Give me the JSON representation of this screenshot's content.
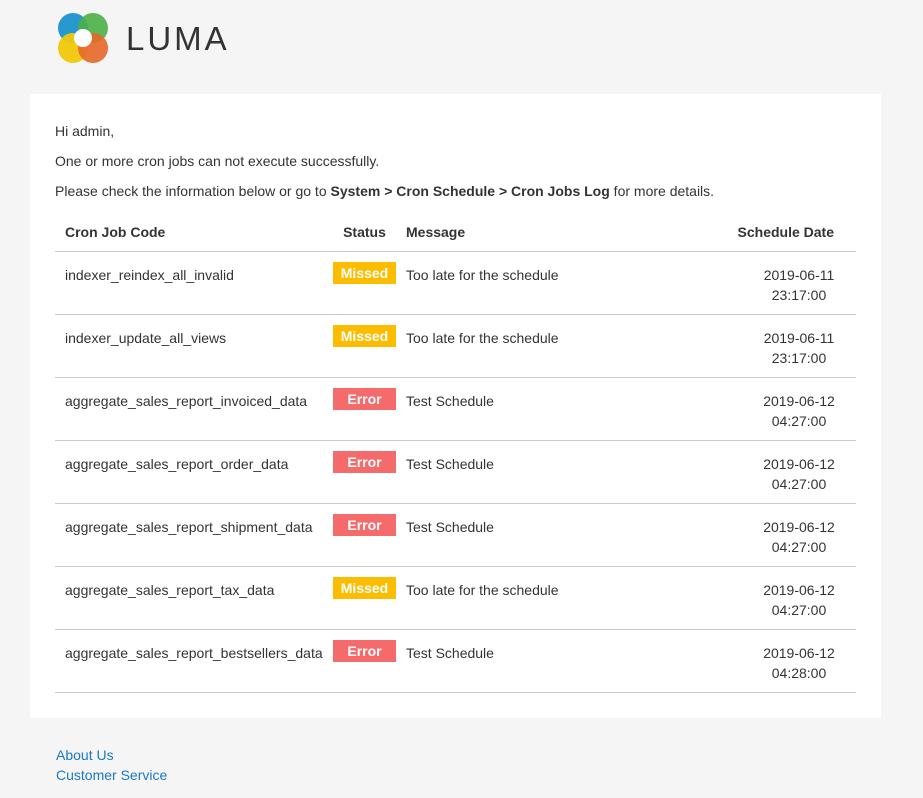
{
  "brand": {
    "name": "LUMA",
    "colors": [
      "#4fb848",
      "#1d9ad6",
      "#f26c2b",
      "#fbd20b"
    ]
  },
  "greeting": "Hi admin,",
  "line1": "One or more cron jobs can not execute successfully.",
  "line2": {
    "before": "Please check the information below or go to ",
    "path": "System > Cron Schedule > Cron Jobs Log",
    "after": " for more details."
  },
  "table": {
    "headers": {
      "code": "Cron Job Code",
      "status": "Status",
      "message": "Message",
      "date": "Schedule Date"
    },
    "rows": [
      {
        "code": "indexer_reindex_all_invalid",
        "status": "Missed",
        "type": "missed",
        "message": "Too late for the schedule",
        "date": "2019-06-11",
        "time": "23:17:00"
      },
      {
        "code": "indexer_update_all_views",
        "status": "Missed",
        "type": "missed",
        "message": "Too late for the schedule",
        "date": "2019-06-11",
        "time": "23:17:00"
      },
      {
        "code": "aggregate_sales_report_invoiced_data",
        "status": "Error",
        "type": "error",
        "message": "Test Schedule",
        "date": "2019-06-12",
        "time": "04:27:00"
      },
      {
        "code": "aggregate_sales_report_order_data",
        "status": "Error",
        "type": "error",
        "message": "Test Schedule",
        "date": "2019-06-12",
        "time": "04:27:00"
      },
      {
        "code": "aggregate_sales_report_shipment_data",
        "status": "Error",
        "type": "error",
        "message": "Test Schedule",
        "date": "2019-06-12",
        "time": "04:27:00"
      },
      {
        "code": "aggregate_sales_report_tax_data",
        "status": "Missed",
        "type": "missed",
        "message": "Too late for the schedule",
        "date": "2019-06-12",
        "time": "04:27:00"
      },
      {
        "code": "aggregate_sales_report_bestsellers_data",
        "status": "Error",
        "type": "error",
        "message": "Test Schedule",
        "date": "2019-06-12",
        "time": "04:28:00"
      }
    ]
  },
  "status_colors": {
    "missed": "#fcbc00",
    "error": "#f56b6b"
  },
  "footer": {
    "links": [
      "About Us",
      "Customer Service"
    ]
  }
}
